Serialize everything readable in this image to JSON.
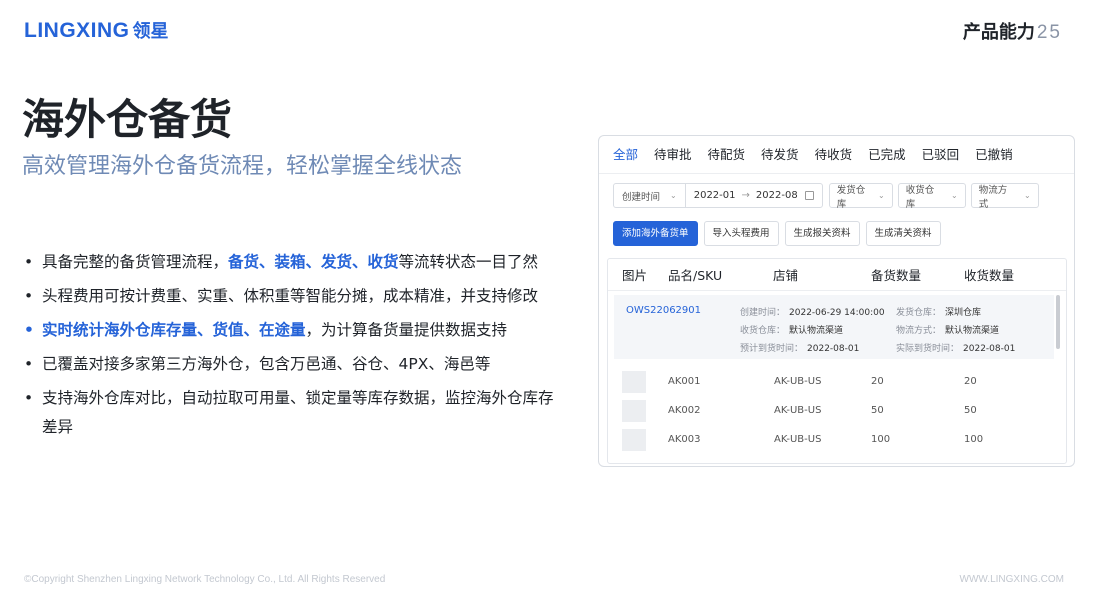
{
  "header": {
    "logo_en": "LINGXING",
    "logo_cn": "领星",
    "section_title": "产品能力",
    "page_number": "25"
  },
  "title": "海外仓备货",
  "subtitle": "高效管理海外仓备货流程，轻松掌握全线状态",
  "bullets": [
    {
      "pre": "具备完整的备货管理流程，",
      "highlight": "备货、装箱、发货、收货",
      "post": "等流转状态一目了然"
    },
    {
      "text": "头程费用可按计费重、实重、体积重等智能分摊，成本精准，并支持修改"
    },
    {
      "highlight": "实时统计海外仓库存量、货值、在途量",
      "post": "，为计算备货量提供数据支持"
    },
    {
      "text": "已覆盖对接多家第三方海外仓，包含万邑通、谷仓、4PX、海邑等"
    },
    {
      "text": "支持海外仓库对比，自动拉取可用量、锁定量等库存数据，监控海外仓库存差异"
    }
  ],
  "ui": {
    "tabs": [
      "全部",
      "待审批",
      "待配货",
      "待发货",
      "待收货",
      "已完成",
      "已驳回",
      "已撤销"
    ],
    "active_tab": 0,
    "filters": {
      "date_type": "创建时间",
      "date_start": "2022-01",
      "date_end": "2022-08",
      "ship_warehouse": "发货仓库",
      "recv_warehouse": "收货仓库",
      "logistics": "物流方式"
    },
    "buttons": [
      "添加海外备货单",
      "导入头程费用",
      "生成报关资料",
      "生成清关资料"
    ],
    "columns": [
      "图片",
      "品名/SKU",
      "店铺",
      "备货数量",
      "收货数量"
    ],
    "order": {
      "id": "OWS22062901",
      "created_label": "创建时间：",
      "created_value": "2022-06-29 14:00:00",
      "ship_wh_label": "发货仓库：",
      "ship_wh_value": "深圳仓库",
      "recv_wh_label": "收货仓库：",
      "recv_wh_value": "默认物流渠道",
      "logistics_label": "物流方式：",
      "logistics_value": "默认物流渠道",
      "eta_label": "预计到货时间：",
      "eta_value": "2022-08-01",
      "ata_label": "实际到货时间：",
      "ata_value": "2022-08-01"
    },
    "rows": [
      {
        "sku": "AK001",
        "shop": "AK-UB-US",
        "stock_qty": "20",
        "recv_qty": "20"
      },
      {
        "sku": "AK002",
        "shop": "AK-UB-US",
        "stock_qty": "50",
        "recv_qty": "50"
      },
      {
        "sku": "AK003",
        "shop": "AK-UB-US",
        "stock_qty": "100",
        "recv_qty": "100"
      }
    ]
  },
  "footer": {
    "copyright": "©Copyright Shenzhen Lingxing Network Technology Co., Ltd. All Rights Reserved",
    "website": "WWW.LINGXING.COM"
  }
}
